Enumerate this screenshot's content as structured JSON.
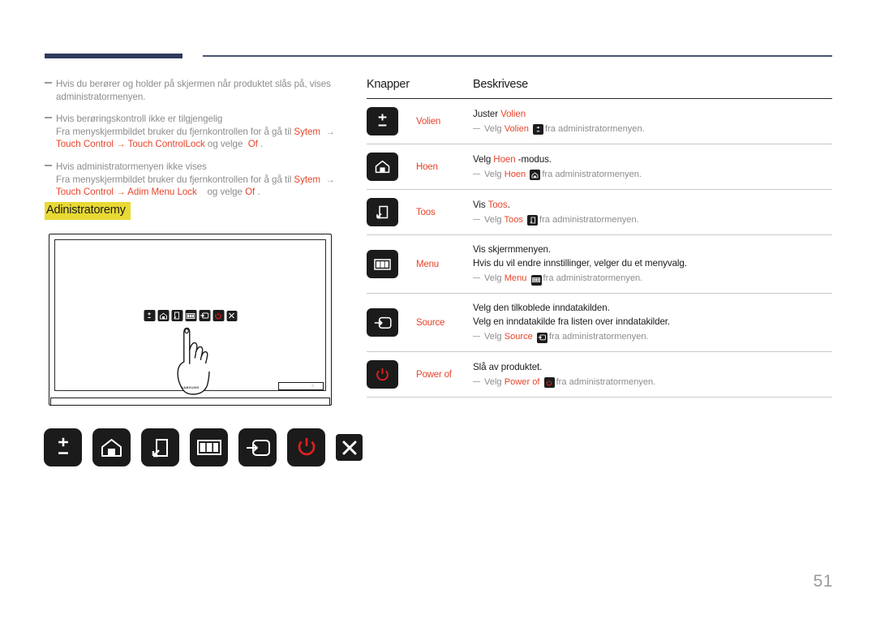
{
  "page": {
    "number": "51",
    "admin_heading": "Adinistratoremy"
  },
  "notes": [
    {
      "lines": [
        {
          "text": "Hvis du berører og holder på skjermen når produktet slås på, vises",
          "color": "gray"
        },
        {
          "text": "administratormenyen.",
          "color": "gray"
        }
      ]
    },
    {
      "lines": [
        {
          "text": "Hvis berøringskontroll ikke er tilgjengelig",
          "color": "gray"
        }
      ],
      "path_line1_pre": "Fra menyskjermbildet bruker du fjernkontrollen for å gå til ",
      "path_line1_hl": "Sytem",
      "path_line1_arrow": "→",
      "path_line2_hl1": "Touch Control",
      "path_line2_arrow": "→",
      "path_line2_hl2": "Touch ControlLock",
      "path_line2_mid": " og velge ",
      "path_line2_hl3": "Of",
      "path_line2_end": "."
    },
    {
      "lines": [
        {
          "text": "Hvis administratormenyen ikke vises",
          "color": "gray"
        }
      ],
      "path_line1_pre": "Fra menyskjermbildet bruker du fjernkontrollen for å gå til ",
      "path_line1_hl": "Sytem",
      "path_line1_arrow": "→",
      "path_line2_hl1": "Touch Control",
      "path_line2_arrow": "→",
      "path_line2_hl2": "Adim Menu Lock",
      "path_line2_mid": " og velge ",
      "path_line2_hl3": "Of",
      "path_line2_end": "."
    }
  ],
  "illustration": {
    "brand": "SAMSUNG",
    "toolbar_icons": [
      "volume-icon",
      "home-icon",
      "tools-icon",
      "menu-icon",
      "source-icon",
      "power-icon",
      "close-icon"
    ]
  },
  "key_row": [
    {
      "name": "volume-key",
      "icon": "volume-icon"
    },
    {
      "name": "home-key",
      "icon": "home-icon"
    },
    {
      "name": "tools-key",
      "icon": "tools-icon"
    },
    {
      "name": "menu-key",
      "icon": "menu-icon"
    },
    {
      "name": "source-key",
      "icon": "source-icon"
    },
    {
      "name": "power-key",
      "icon": "power-icon"
    },
    {
      "name": "close-key",
      "icon": "close-icon"
    }
  ],
  "table": {
    "headers": {
      "buttons": "Knapper",
      "description": "Beskrivese"
    },
    "rows": [
      {
        "icon": "volume-icon",
        "label": "Volien",
        "desc_pre": "Juster ",
        "desc_hl": "Volien",
        "desc_post": "",
        "sub_pre": "Velg ",
        "sub_hl": "Volien",
        "sub_icon": "volume-icon",
        "sub_post": "fra administratormenyen."
      },
      {
        "icon": "home-icon",
        "label": "Hoen",
        "desc_pre": "Velg ",
        "desc_hl": "Hoen",
        "desc_post": " -modus.",
        "sub_pre": "Velg ",
        "sub_hl": "Hoen",
        "sub_icon": "home-icon",
        "sub_post": "fra administratormenyen."
      },
      {
        "icon": "tools-icon",
        "label": "Toos",
        "desc_pre": "Vis ",
        "desc_hl": "Toos",
        "desc_post": ".",
        "sub_pre": "Velg ",
        "sub_hl": "Toos",
        "sub_icon": "tools-icon",
        "sub_post": "fra administratormenyen."
      },
      {
        "icon": "menu-icon",
        "label": "Menu",
        "desc_extra": "Vis skjermmenyen.",
        "desc_pre": "Hvis du vil endre innstillinger, velger du et menyvalg.",
        "desc_hl": "",
        "desc_post": "",
        "sub_pre": "Velg ",
        "sub_hl": "Menu",
        "sub_icon": "menu-icon",
        "sub_post": "fra administratormenyen."
      },
      {
        "icon": "source-icon",
        "label": "Source",
        "desc_extra": "Velg den tilkoblede inndatakilden.",
        "desc_pre": "Velg en inndatakilde fra listen over inndatakilder.",
        "desc_hl": "",
        "desc_post": "",
        "sub_pre": "Velg ",
        "sub_hl": "Source",
        "sub_icon": "source-icon",
        "sub_post": "fra administratormenyen."
      },
      {
        "icon": "power-icon",
        "label": "Power of",
        "desc_pre": "Slå av produktet.",
        "desc_hl": "",
        "desc_post": "",
        "sub_pre": "Velg ",
        "sub_hl": "Power of",
        "sub_icon": "power-icon",
        "sub_post": "fra administratormenyen."
      }
    ]
  },
  "colors": {
    "accent_red": "#e8442a",
    "rule_navy": "#2e3a5c",
    "highlight_yellow": "#e8d934",
    "key_black": "#1b1b1b",
    "power_red": "#e02020"
  }
}
